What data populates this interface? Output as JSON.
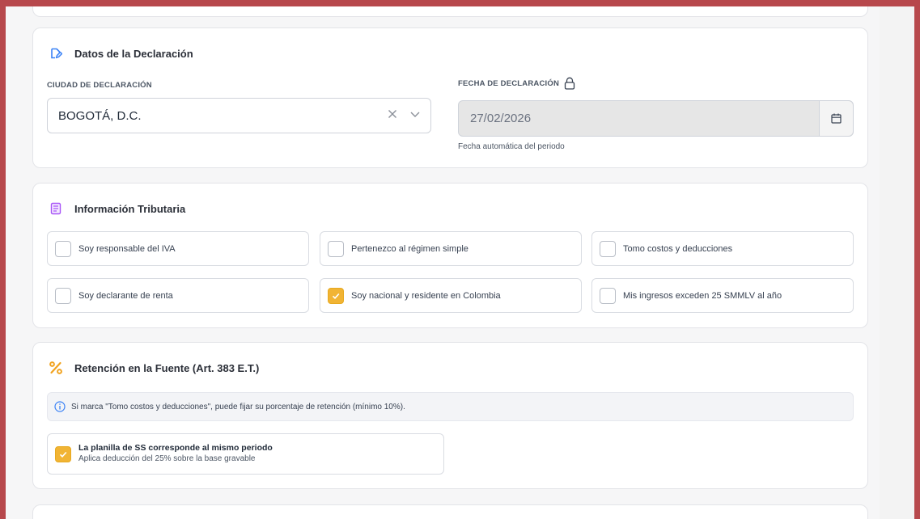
{
  "datos": {
    "title": "Datos de la Declaración",
    "title_icon": "edit-document-icon",
    "ciudad_label": "CIUDAD DE DECLARACIÓN",
    "ciudad_value": "BOGOTÁ, D.C.",
    "fecha_label": "FECHA DE DECLARACIÓN",
    "fecha_value": "27/02/2026",
    "fecha_helper": "Fecha automática del periodo"
  },
  "info": {
    "title": "Información Tributaria",
    "title_icon": "clipboard-list-icon",
    "options": [
      {
        "label": "Soy responsable del IVA",
        "checked": false
      },
      {
        "label": "Pertenezco al régimen simple",
        "checked": false
      },
      {
        "label": "Tomo costos y deducciones",
        "checked": false
      },
      {
        "label": "Soy declarante de renta",
        "checked": false
      },
      {
        "label": "Soy nacional y residente en Colombia",
        "checked": true
      },
      {
        "label": "Mis ingresos exceden 25 SMMLV al año",
        "checked": false
      }
    ]
  },
  "retencion": {
    "title": "Retención en la Fuente (Art. 383 E.T.)",
    "title_icon": "percent-icon",
    "info_text": "Si marca \"Tomo costos y deducciones\", puede fijar su porcentaje de retención (mínimo 10%).",
    "ss_title": "La planilla de SS corresponde al mismo periodo",
    "ss_subtitle": "Aplica deducción del 25% sobre la base gravable",
    "ss_checked": true
  },
  "colors": {
    "frame": "#b7484c",
    "accent_orange": "#f1b434",
    "accent_blue": "#3b82f6",
    "accent_purple": "#a855f7"
  }
}
